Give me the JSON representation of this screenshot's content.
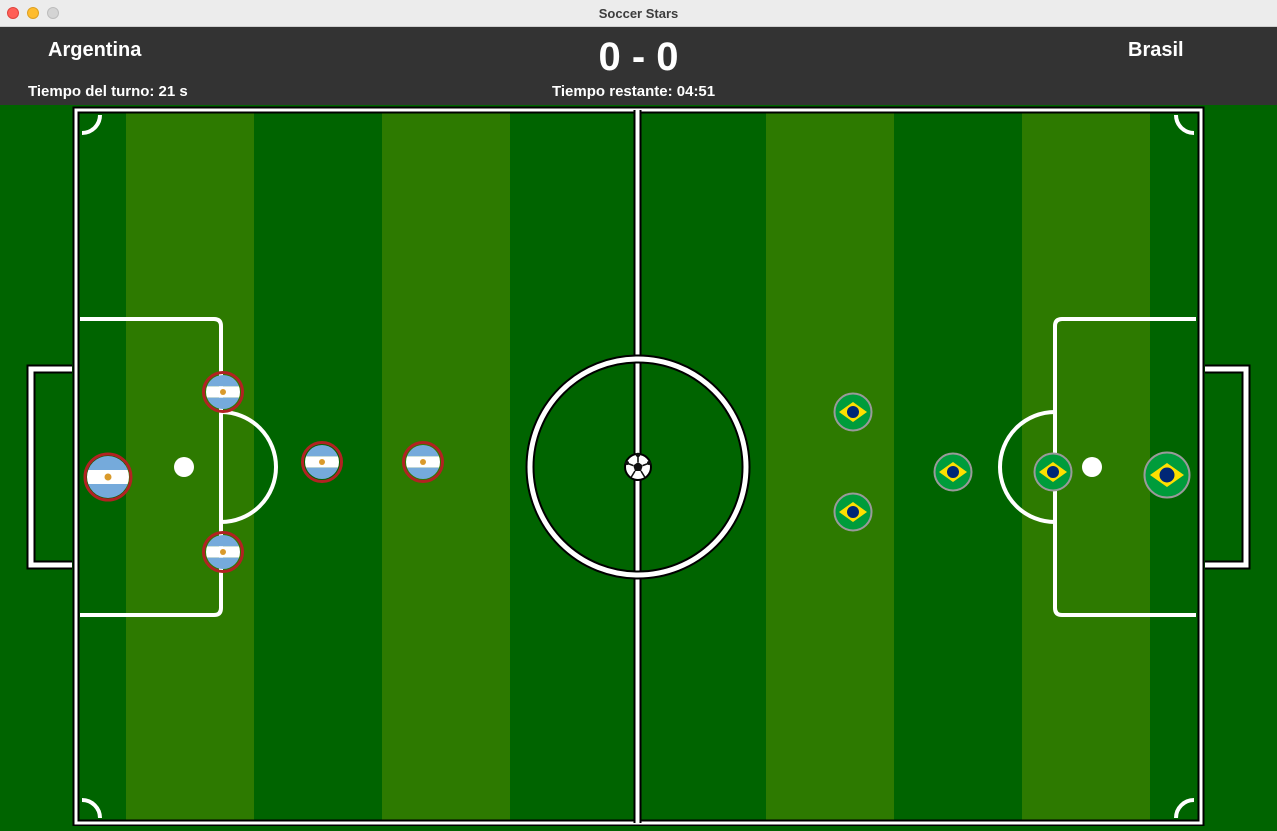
{
  "window": {
    "title": "Soccer Stars"
  },
  "scoreboard": {
    "home_team": "Argentina",
    "away_team": "Brasil",
    "score": "0 - 0",
    "turn_time": "Tiempo del turno: 21 s",
    "remaining_time": "Tiempo restante: 04:51"
  },
  "colors": {
    "pitch_dark": "#006400",
    "pitch_light": "#2d7a00",
    "scorebar": "#333333",
    "argentina_ring": "#b22222",
    "argentina_sky": "#75aadb",
    "brasil_green": "#009c3b",
    "brasil_yellow": "#ffdf00",
    "brasil_blue": "#002776"
  }
}
